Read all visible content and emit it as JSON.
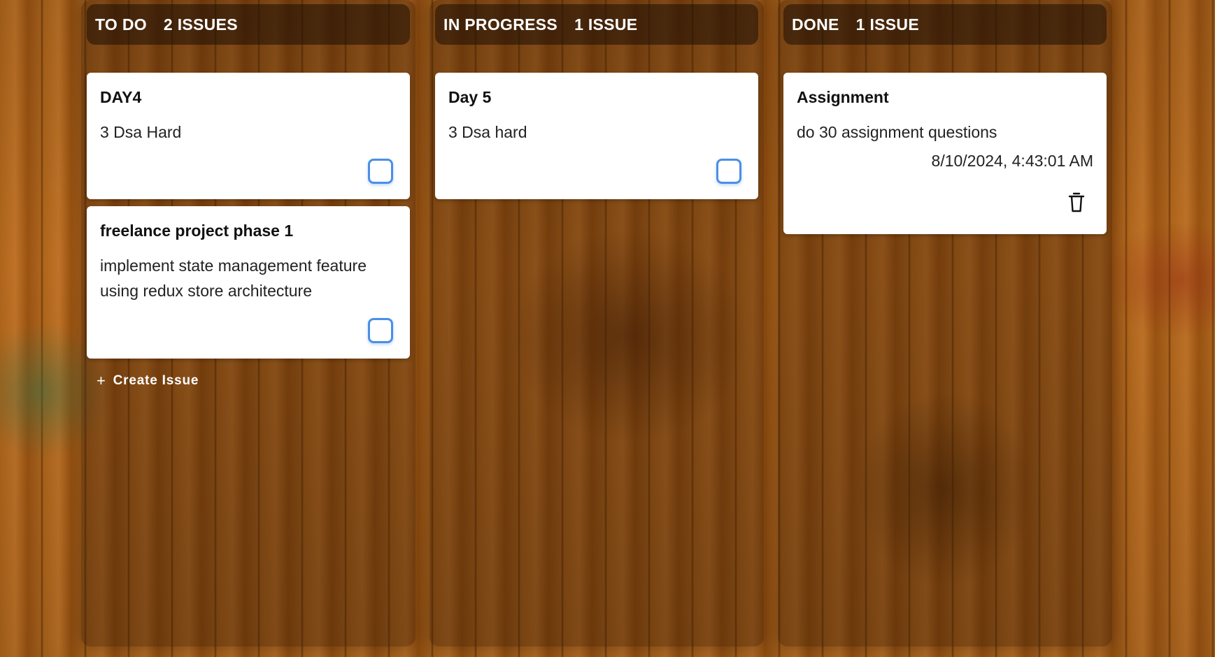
{
  "columns": [
    {
      "title": "TO DO",
      "count": "2 ISSUES",
      "cards": [
        {
          "title": "DAY4",
          "description": "3 Dsa Hard"
        },
        {
          "title": "freelance project phase 1",
          "description": "implement state management feature using redux store architecture"
        }
      ],
      "create_label": "Create Issue"
    },
    {
      "title": "IN PROGRESS",
      "count": "1 ISSUE",
      "cards": [
        {
          "title": "Day 5",
          "description": "3 Dsa hard"
        }
      ]
    },
    {
      "title": "DONE",
      "count": "1 ISSUE",
      "cards": [
        {
          "title": "Assignment",
          "description": "do 30 assignment questions",
          "completed_at": "8/10/2024, 4:43:01 AM"
        }
      ]
    }
  ],
  "colors": {
    "checkbox_border": "#4a8fe7",
    "card_background": "#ffffff",
    "header_text": "#ffffff"
  },
  "icons": {
    "checkbox": "checkbox-icon",
    "delete": "trash-icon",
    "create": "plus-icon"
  }
}
